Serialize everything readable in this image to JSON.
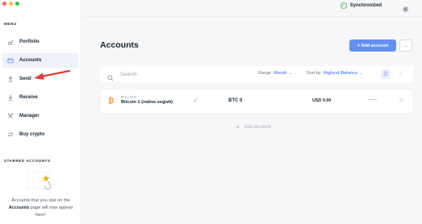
{
  "window": {
    "traffic_colors": [
      "#fd5f57",
      "#fdbc2e",
      "#28c840"
    ]
  },
  "sidebar": {
    "menu_label": "MENU",
    "items": [
      {
        "label": "Portfolio",
        "icon": "portfolio-icon",
        "active": false
      },
      {
        "label": "Accounts",
        "icon": "accounts-icon",
        "active": true
      },
      {
        "label": "Send",
        "icon": "send-icon",
        "active": false
      },
      {
        "label": "Receive",
        "icon": "receive-icon",
        "active": false
      },
      {
        "label": "Manager",
        "icon": "manager-icon",
        "active": false
      },
      {
        "label": "Buy crypto",
        "icon": "buy-crypto-icon",
        "active": false
      }
    ],
    "starred_label": "STARRED ACCOUNTS",
    "starred_text_1": "Accounts that you star on the",
    "starred_text_bold": "Accounts",
    "starred_text_2": "page will now appear here!"
  },
  "topbar": {
    "sync_status": "Synchronized"
  },
  "main": {
    "title": "Accounts",
    "add_account_label": "+ Add account",
    "more_label": "...",
    "search_placeholder": "Search",
    "range_label": "Range",
    "range_value": "Month",
    "sort_label": "Sort by",
    "sort_value": "Highest Balance",
    "accounts": [
      {
        "currency": "BITCOIN",
        "name": "Bitcoin 1 (native segwit)",
        "balance": "BTC 0",
        "countervalue": "USD 0.00",
        "coin_color": "#f7931a"
      }
    ],
    "add_account_row_label": "Add account"
  },
  "colors": {
    "accent": "#6490f1",
    "success": "#66be54",
    "annotation": "#e53935"
  }
}
